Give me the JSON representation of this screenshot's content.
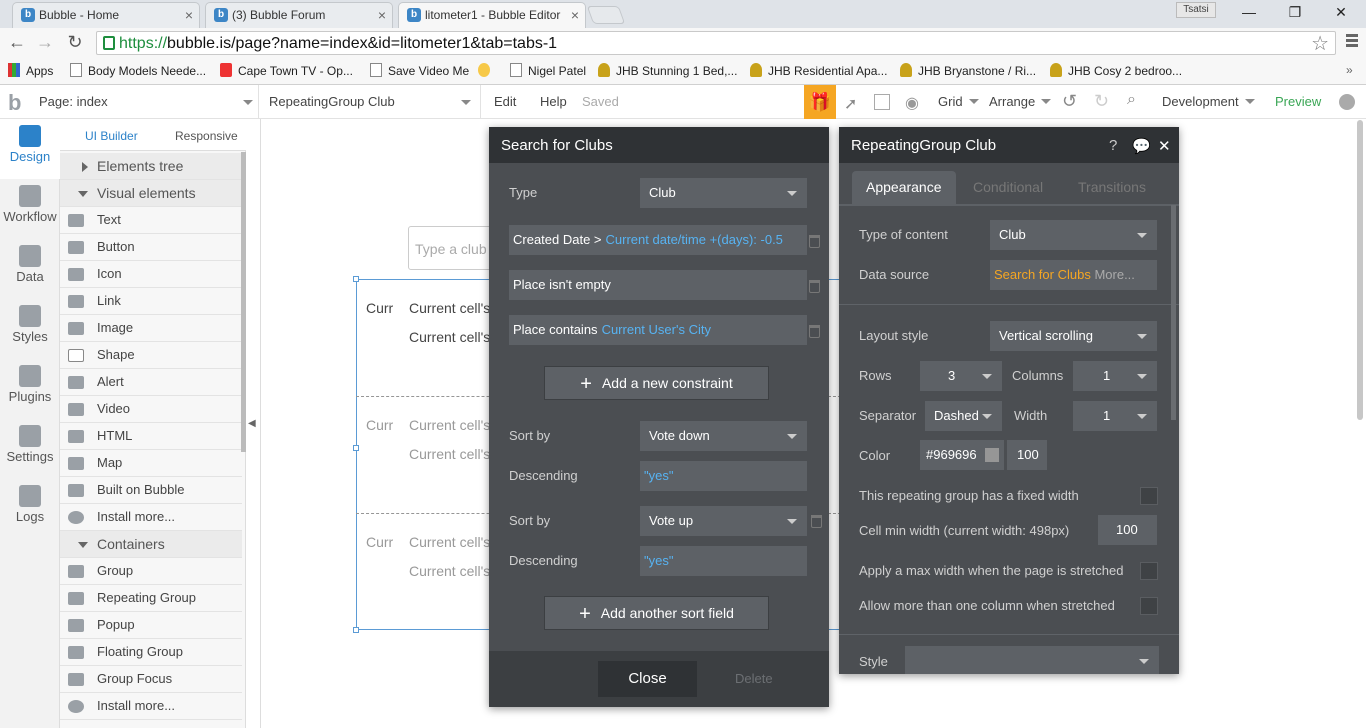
{
  "browser": {
    "tabs": [
      {
        "title": "Bubble - Home"
      },
      {
        "title": "(3) Bubble Forum"
      },
      {
        "title": "litometer1 - Bubble Editor"
      }
    ],
    "user_label": "Tsatsi",
    "url_scheme": "https://",
    "url_rest": "bubble.is/page?name=index&id=litometer1&tab=tabs-1",
    "bookmarks": [
      {
        "label": "Apps",
        "icon": "apps-icon"
      },
      {
        "label": "Body Models Neede...",
        "icon": "page-icon"
      },
      {
        "label": "Cape Town TV - Op...",
        "icon": "ctv-icon"
      },
      {
        "label": "Save Video Me",
        "icon": "page-icon"
      },
      {
        "label": "",
        "icon": "yellow-circle-icon"
      },
      {
        "label": "Nigel Patel",
        "icon": "page-icon"
      },
      {
        "label": "JHB Stunning 1 Bed,...",
        "icon": "house-icon"
      },
      {
        "label": "JHB Residential Apa...",
        "icon": "house-icon"
      },
      {
        "label": "JHB Bryanstone / Ri...",
        "icon": "house-icon"
      },
      {
        "label": "JHB Cosy 2 bedroo...",
        "icon": "house-icon"
      }
    ]
  },
  "editor_bar": {
    "page_label": "Page: index",
    "element_label": "RepeatingGroup Club",
    "edit": "Edit",
    "help": "Help",
    "saved": "Saved",
    "grid": "Grid",
    "arrange": "Arrange",
    "development": "Development",
    "preview": "Preview",
    "accent": "#f5a623"
  },
  "rail": {
    "items": [
      {
        "label": "Design"
      },
      {
        "label": "Workflow"
      },
      {
        "label": "Data"
      },
      {
        "label": "Styles"
      },
      {
        "label": "Plugins"
      },
      {
        "label": "Settings"
      },
      {
        "label": "Logs"
      }
    ]
  },
  "panel": {
    "tab_ui": "UI Builder",
    "tab_responsive": "Responsive",
    "elements_tree": "Elements tree",
    "visual_elements": "Visual elements",
    "visual": [
      "Text",
      "Button",
      "Icon",
      "Link",
      "Image",
      "Shape",
      "Alert",
      "Video",
      "HTML",
      "Map",
      "Built on Bubble",
      "Install more..."
    ],
    "containers": "Containers",
    "container_items": [
      "Group",
      "Repeating Group",
      "Popup",
      "Floating Group",
      "Group Focus",
      "Install more..."
    ]
  },
  "canvas": {
    "input_placeholder": "Type a club n",
    "curr": "Curr",
    "cell_text": "Current cell's"
  },
  "search": {
    "title": "Search for Clubs",
    "type_label": "Type",
    "type_value": "Club",
    "constraints": [
      {
        "field": "Created Date >",
        "value": "Current date/time +(days): -0.5"
      },
      {
        "field": "Place isn't empty",
        "value": ""
      },
      {
        "field": "Place contains",
        "value": "Current User's City"
      }
    ],
    "add_constraint": "Add a new constraint",
    "sort1_label": "Sort by",
    "sort1_value": "Vote down",
    "desc1_label": "Descending",
    "desc1_value": "\"yes\"",
    "sort2_label": "Sort by",
    "sort2_value": "Vote up",
    "desc2_label": "Descending",
    "desc2_value": "\"yes\"",
    "add_sort": "Add another sort field",
    "close": "Close",
    "delete": "Delete"
  },
  "props": {
    "title": "RepeatingGroup Club",
    "tabs": [
      "Appearance",
      "Conditional",
      "Transitions"
    ],
    "type_of_content_label": "Type of content",
    "type_of_content": "Club",
    "data_source_label": "Data source",
    "data_source": "Search for Clubs",
    "data_source_more": "More...",
    "layout_style_label": "Layout style",
    "layout_style": "Vertical scrolling",
    "rows_label": "Rows",
    "rows": "3",
    "columns_label": "Columns",
    "columns": "1",
    "separator_label": "Separator",
    "separator": "Dashed",
    "width_label": "Width",
    "width": "1",
    "color_label": "Color",
    "color_hex": "#969696",
    "color_opacity": "100",
    "fixed_width": "This repeating group has a fixed width",
    "cell_min_width_label": "Cell min width (current width: 498px)",
    "cell_min_width": "100",
    "max_width": "Apply a max width when the page is stretched",
    "more_columns": "Allow more than one column when stretched",
    "style_label": "Style"
  }
}
